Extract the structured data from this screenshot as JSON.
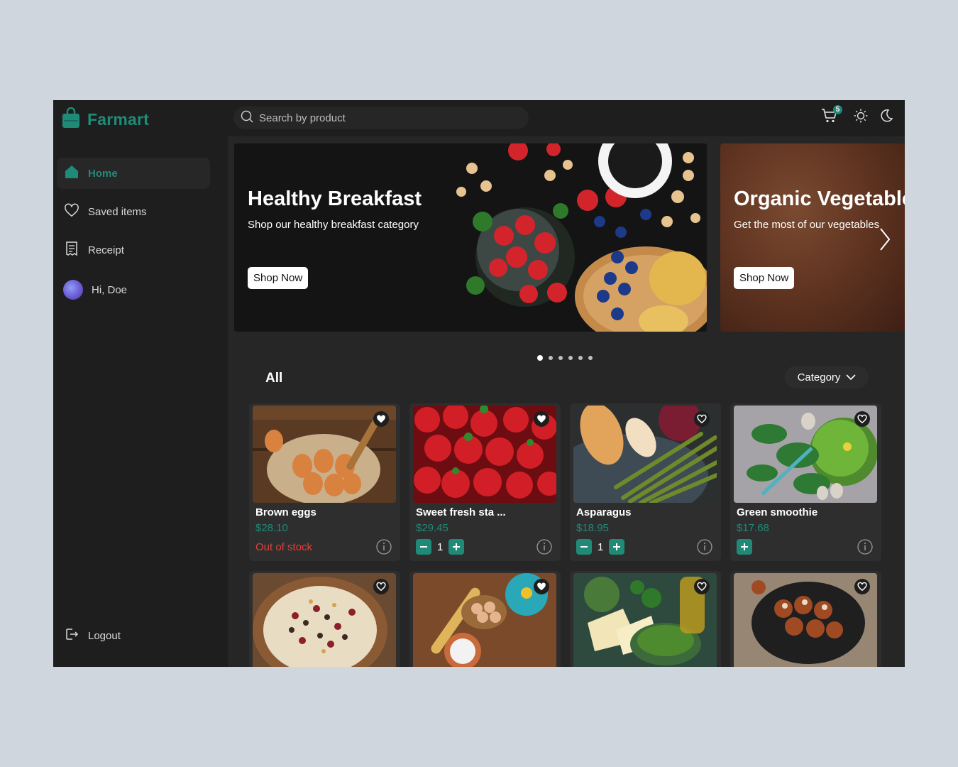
{
  "brand": {
    "name": "Farmart",
    "color": "#1f8a78"
  },
  "search": {
    "placeholder": "Search by product"
  },
  "cart": {
    "count": "5"
  },
  "sidebar": {
    "items": [
      {
        "label": "Home",
        "icon": "home-icon",
        "active": true
      },
      {
        "label": "Saved items",
        "icon": "heart-icon"
      },
      {
        "label": "Receipt",
        "icon": "receipt-icon"
      },
      {
        "label": "Hi, Doe",
        "icon": "avatar"
      }
    ],
    "logout": "Logout"
  },
  "banners": [
    {
      "title": "Healthy Breakfast",
      "subtitle": "Shop our healthy breakfast category",
      "button": "Shop Now"
    },
    {
      "title": "Organic Vegetables",
      "subtitle": "Get the most of our vegetables",
      "button": "Shop Now"
    }
  ],
  "carousel": {
    "total": 6,
    "active": 0
  },
  "section": {
    "title": "All",
    "category_label": "Category"
  },
  "products": [
    {
      "name": "Brown eggs",
      "price": "$28.10",
      "status": "Out of stock"
    },
    {
      "name": "Sweet fresh sta ...",
      "price": "$29.45",
      "qty": "1"
    },
    {
      "name": "Asparagus",
      "price": "$18.95",
      "qty": "1"
    },
    {
      "name": "Green smoothie",
      "price": "$17.68"
    }
  ],
  "colors": {
    "accent": "#1f8a78",
    "danger": "#e0413b",
    "background": "#1e1e1e"
  }
}
